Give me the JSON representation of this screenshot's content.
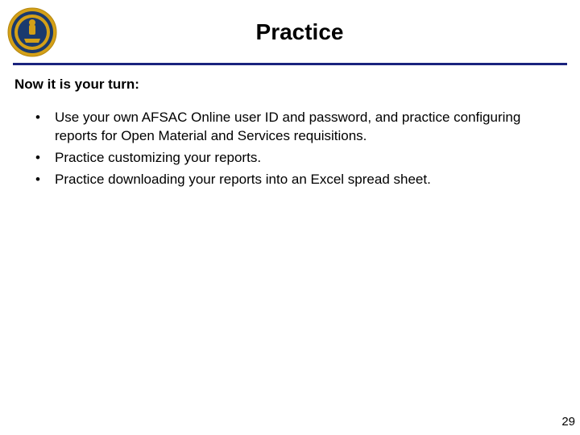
{
  "title": "Practice",
  "subheading": "Now it is your turn:",
  "bullets": [
    "Use your own AFSAC Online user ID and password, and practice configuring reports for Open Material and Services requisitions.",
    "Practice customizing your reports.",
    "Practice downloading your reports into an Excel spread sheet."
  ],
  "page_number": "29",
  "colors": {
    "divider": "#1a237e",
    "seal_gold": "#d4a017",
    "seal_blue": "#1a3a6e"
  }
}
